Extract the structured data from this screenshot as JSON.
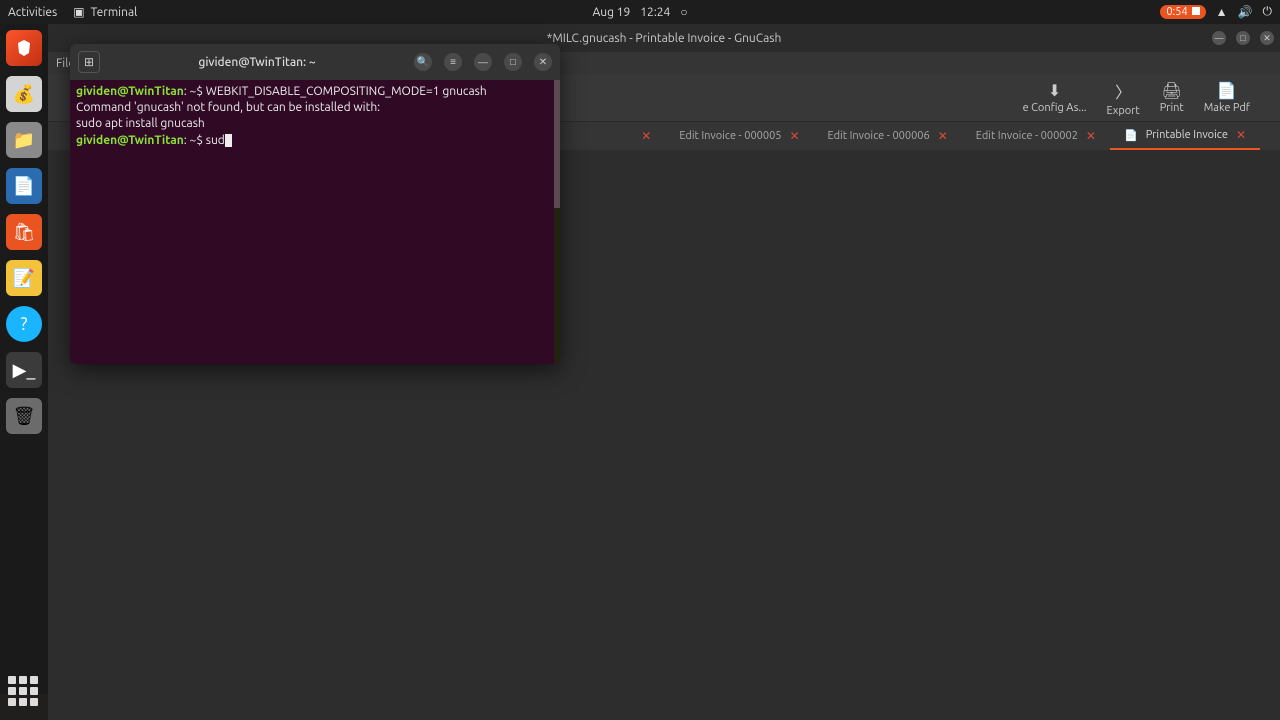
{
  "topbar": {
    "activities": "Activities",
    "app_name": "Terminal",
    "date": "Aug 19",
    "time": "12:24",
    "badge_time": "0:54"
  },
  "gnucash": {
    "title": "*MILC.gnucash - Printable Invoice - GnuCash",
    "menu_file": "File",
    "toolbar": {
      "config_as": "e Config As...",
      "export": "Export",
      "print": "Print",
      "make_pdf": "Make Pdf"
    },
    "tabs": {
      "t1": "Edit Invoice - 000005",
      "t2": "Edit Invoice - 000006",
      "t3": "Edit Invoice - 000002",
      "t4": "Printable Invoice"
    }
  },
  "terminal": {
    "title": "gividen@TwinTitan: ~",
    "line1_user": "gividen@TwinTitan",
    "line1_rest": ": ~$ WEBKIT_DISABLE_COMPOSITING_MODE=1 gnucash",
    "line2": "Command 'gnucash' not found, but can be installed with:",
    "line3": "sudo apt install gnucash",
    "line4_user": "gividen@TwinTitan",
    "line4_rest": ": ~$ sud"
  }
}
